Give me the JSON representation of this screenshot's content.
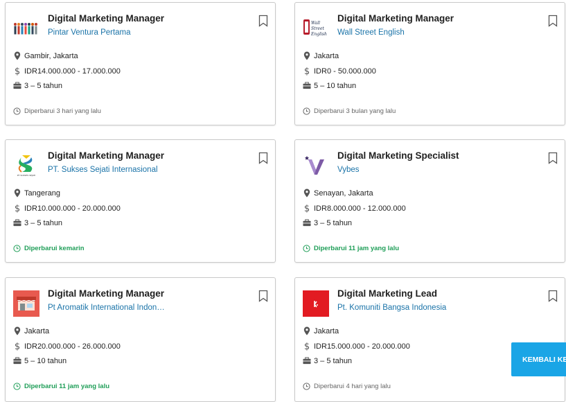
{
  "jobs": [
    {
      "title": "Digital Marketing Manager",
      "company": "Pintar Ventura Pertama",
      "location": "Gambir, Jakarta",
      "salary": "IDR14.000.000 - 17.000.000",
      "experience": "3 – 5 tahun",
      "updated": "Diperbarui 3 hari yang lalu",
      "logo_icon": "people-group-logo"
    },
    {
      "title": "Digital Marketing Manager",
      "company": "Wall Street English",
      "location": "Jakarta",
      "salary": "IDR0 - 50.000.000",
      "experience": "5 – 10 tahun",
      "updated": "Diperbarui 3 bulan yang lalu",
      "logo_icon": "wall-street-english-logo",
      "logo_text": "Wall Street English"
    },
    {
      "title": "Digital Marketing Manager",
      "company": "PT. Sukses Sejati Internasional",
      "location": "Tangerang",
      "salary": "IDR10.000.000 - 20.000.000",
      "experience": "3 – 5 tahun",
      "updated": "Diperbarui kemarin",
      "logo_icon": "sukses-sejati-logo",
      "logo_text": "PT SUKSES SEJATI INTERNASIONAL"
    },
    {
      "title": "Digital Marketing Specialist",
      "company": "Vybes",
      "location": "Senayan, Jakarta",
      "salary": "IDR8.000.000 - 12.000.000",
      "experience": "3 – 5 tahun",
      "updated": "Diperbarui 11 jam yang lalu",
      "logo_icon": "vybes-logo"
    },
    {
      "title": "Digital Marketing Manager",
      "company": "Pt Aromatik International Indonesia",
      "location": "Jakarta",
      "salary": "IDR20.000.000 - 26.000.000",
      "experience": "5 – 10 tahun",
      "updated": "Diperbarui 11 jam yang lalu",
      "logo_icon": "storefront-logo"
    },
    {
      "title": "Digital Marketing Lead",
      "company": "Pt. Komuniti Bangsa Indonesia",
      "location": "Jakarta",
      "salary": "IDR15.000.000 - 20.000.000",
      "experience": "3 – 5 tahun",
      "updated": "Diperbarui 4 hari yang lalu",
      "logo_icon": "komuniti-logo"
    }
  ],
  "back_button": {
    "label": "KEMBALI KE"
  },
  "colors": {
    "title": "#1f1f1f",
    "company_link": "#1a73a8",
    "fresh_update": "#1f9e58",
    "stale_update": "#666666",
    "back_button_bg": "#1aa5e6",
    "card_border": "#c9c9c9"
  }
}
